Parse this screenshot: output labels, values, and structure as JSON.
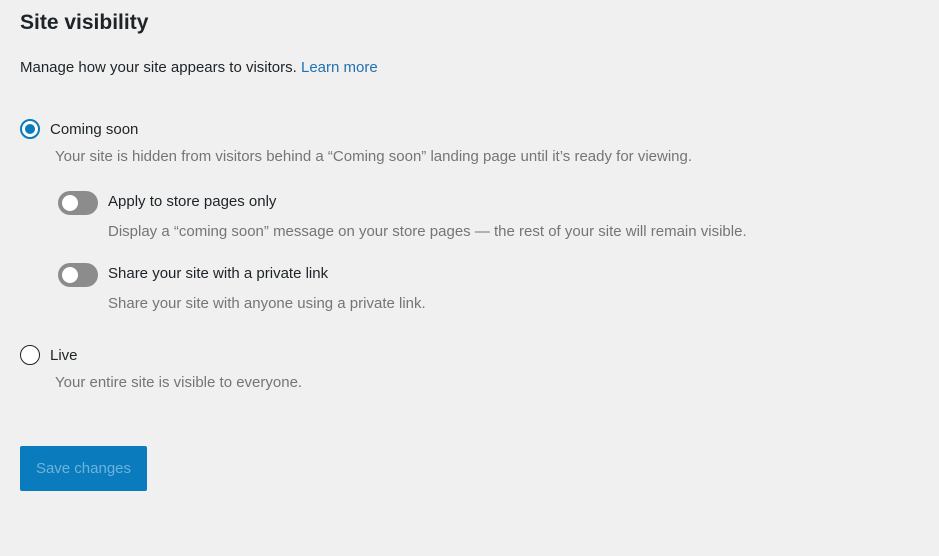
{
  "section": {
    "title": "Site visibility",
    "description": "Manage how your site appears to visitors.",
    "learn_more": "Learn more"
  },
  "options": {
    "coming_soon": {
      "label": "Coming soon",
      "help": "Your site is hidden from visitors behind a “Coming soon” landing page until it’s ready for viewing.",
      "selected": true
    },
    "store_pages": {
      "label": "Apply to store pages only",
      "help": "Display a “coming soon” message on your store pages — the rest of your site will remain visible.",
      "enabled": false
    },
    "private_link": {
      "label": "Share your site with a private link",
      "help": "Share your site with anyone using a private link.",
      "enabled": false
    },
    "live": {
      "label": "Live",
      "help": "Your entire site is visible to everyone.",
      "selected": false
    }
  },
  "actions": {
    "save_label": "Save changes"
  },
  "colors": {
    "accent": "#0a7bbd",
    "link": "#2271b1",
    "toggle_off": "#8c8c8c",
    "background": "#f0f0f1"
  }
}
